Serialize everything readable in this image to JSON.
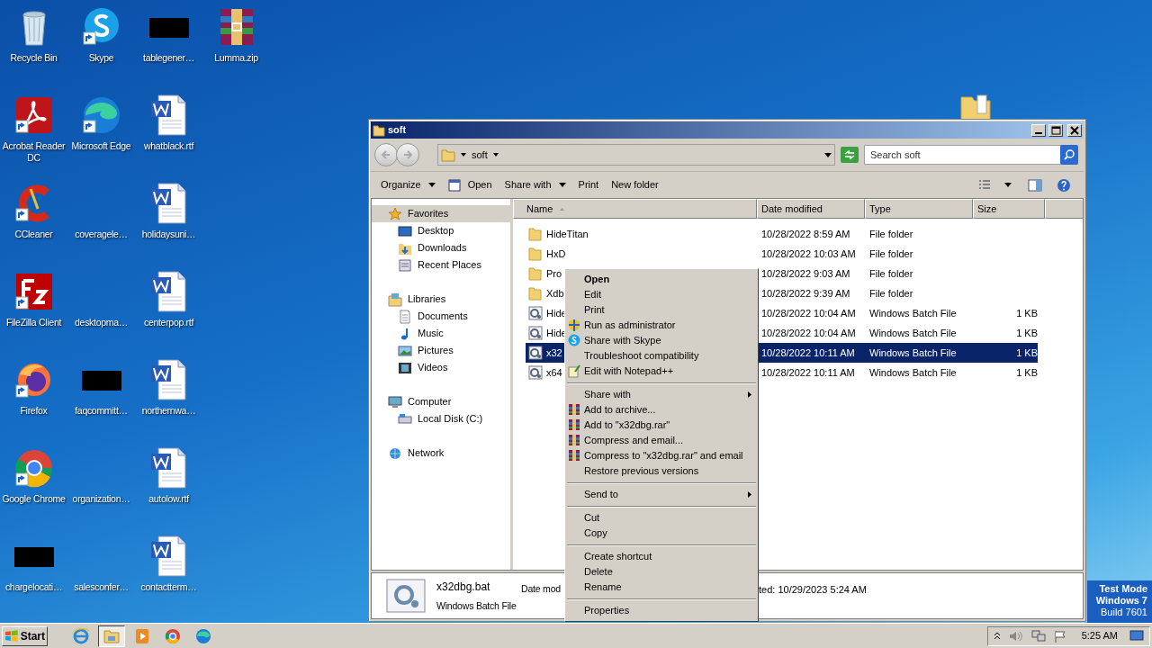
{
  "desktop": {
    "icons": [
      {
        "label": "Recycle Bin",
        "kind": "recycle"
      },
      {
        "label": "Acrobat Reader DC",
        "kind": "acrobat"
      },
      {
        "label": "CCleaner",
        "kind": "ccleaner"
      },
      {
        "label": "FileZilla Client",
        "kind": "filezilla"
      },
      {
        "label": "Firefox",
        "kind": "firefox"
      },
      {
        "label": "Google Chrome",
        "kind": "chrome"
      },
      {
        "label": "chargelocati…",
        "kind": "hidden"
      },
      {
        "label": "Skype",
        "kind": "skype"
      },
      {
        "label": "Microsoft Edge",
        "kind": "edge"
      },
      {
        "label": "coveragele…",
        "kind": "blank"
      },
      {
        "label": "desktopma…",
        "kind": "blank"
      },
      {
        "label": "faqcommitt…",
        "kind": "hidden"
      },
      {
        "label": "organization…",
        "kind": "blank"
      },
      {
        "label": "salesconfer…",
        "kind": "blank"
      },
      {
        "label": "tablegener…",
        "kind": "hidden"
      },
      {
        "label": "whatblack.rtf",
        "kind": "word"
      },
      {
        "label": "holidaysuni…",
        "kind": "word"
      },
      {
        "label": "centerpop.rtf",
        "kind": "word"
      },
      {
        "label": "northernwa…",
        "kind": "word"
      },
      {
        "label": "autolow.rtf",
        "kind": "word"
      },
      {
        "label": "contactterm…",
        "kind": "word"
      },
      {
        "label": "Lumma.zip",
        "kind": "winrar"
      }
    ],
    "os_notice": [
      "Test Mode",
      "Windows 7",
      "Build 7601"
    ]
  },
  "window": {
    "title": "soft",
    "address": "soft",
    "search": {
      "placeholder": "Search soft"
    },
    "toolbar": [
      {
        "label": "Organize",
        "kind": "dropdown"
      },
      {
        "label": "Open",
        "kind": "icon"
      },
      {
        "label": "Share with",
        "kind": "dropdown"
      },
      {
        "label": "Print",
        "kind": "plain"
      },
      {
        "label": "New folder",
        "kind": "plain"
      }
    ],
    "nav": [
      {
        "label": "Favorites",
        "kind": "star",
        "selected": true,
        "children": [
          {
            "label": "Desktop",
            "kind": "desktop",
            "selected": false
          },
          {
            "label": "Downloads",
            "kind": "downloads",
            "selected": false
          },
          {
            "label": "Recent Places",
            "kind": "recent",
            "selected": false
          }
        ]
      },
      {
        "label": "Libraries",
        "kind": "library",
        "selected": false,
        "children": [
          {
            "label": "Documents",
            "kind": "documents",
            "selected": false
          },
          {
            "label": "Music",
            "kind": "music",
            "selected": false
          },
          {
            "label": "Pictures",
            "kind": "pictures",
            "selected": false
          },
          {
            "label": "Videos",
            "kind": "videos",
            "selected": false
          }
        ]
      },
      {
        "label": "Computer",
        "kind": "computer",
        "selected": false,
        "children": [
          {
            "label": "Local Disk (C:)",
            "kind": "disk",
            "selected": false
          }
        ]
      },
      {
        "label": "Network",
        "kind": "network",
        "selected": false
      }
    ],
    "table": {
      "columns": [
        {
          "label": "Name",
          "sorted": true
        },
        {
          "label": "Date modified",
          "sorted": false
        },
        {
          "label": "Type",
          "sorted": false
        },
        {
          "label": "Size",
          "sorted": false
        }
      ],
      "rows": [
        {
          "name": "HideTitan",
          "date": "10/28/2022 8:59 AM",
          "type": "File folder",
          "kind": "folder",
          "selected": false
        },
        {
          "name": "HxD",
          "date": "10/28/2022 10:03 AM",
          "type": "File folder",
          "kind": "folder",
          "selected": false
        },
        {
          "name": "Pro",
          "date": "10/28/2022 9:03 AM",
          "type": "File folder",
          "kind": "folder",
          "selected": false
        },
        {
          "name": "Xdb",
          "date": "10/28/2022 9:39 AM",
          "type": "File folder",
          "kind": "folder",
          "selected": false
        },
        {
          "name": "Hide",
          "date": "10/28/2022 10:04 AM",
          "type": "Windows Batch File",
          "size": "1 KB",
          "kind": "batch",
          "selected": false
        },
        {
          "name": "Hide",
          "date": "10/28/2022 10:04 AM",
          "type": "Windows Batch File",
          "size": "1 KB",
          "kind": "batch",
          "selected": false
        },
        {
          "name": "x32",
          "date": "10/28/2022 10:11 AM",
          "type": "Windows Batch File",
          "size": "1 KB",
          "kind": "batch",
          "selected": true
        },
        {
          "name": "x64",
          "date": "10/28/2022 10:11 AM",
          "type": "Windows Batch File",
          "size": "1 KB",
          "kind": "batch",
          "selected": false
        }
      ]
    },
    "details": {
      "name": "x32dbg.bat",
      "type": "Windows Batch File",
      "date_label": "Date mod",
      "created": "ted: 10/29/2023 5:24 AM"
    }
  },
  "context_menu": {
    "items": [
      {
        "kind": "default",
        "label": "Open"
      },
      {
        "kind": "command",
        "label": "Edit"
      },
      {
        "kind": "command",
        "label": "Print"
      },
      {
        "kind": "admin",
        "label": "Run as administrator"
      },
      {
        "kind": "skype",
        "label": "Share with Skype"
      },
      {
        "kind": "command",
        "label": "Troubleshoot compatibility"
      },
      {
        "kind": "notepad",
        "label": "Edit with Notepad++"
      },
      {
        "kind": "separator"
      },
      {
        "kind": "submenu",
        "label": "Share with"
      },
      {
        "kind": "archive",
        "label": "Add to archive..."
      },
      {
        "kind": "archive",
        "label": "Add to \"x32dbg.rar\""
      },
      {
        "kind": "archive",
        "label": "Compress and email..."
      },
      {
        "kind": "archive",
        "label": "Compress to \"x32dbg.rar\" and email"
      },
      {
        "kind": "command",
        "label": "Restore previous versions"
      },
      {
        "kind": "separator"
      },
      {
        "kind": "submenu",
        "label": "Send to"
      },
      {
        "kind": "separator"
      },
      {
        "kind": "command",
        "label": "Cut"
      },
      {
        "kind": "command",
        "label": "Copy"
      },
      {
        "kind": "separator"
      },
      {
        "kind": "command",
        "label": "Create shortcut"
      },
      {
        "kind": "command",
        "label": "Delete"
      },
      {
        "kind": "command",
        "label": "Rename"
      },
      {
        "kind": "separator"
      },
      {
        "kind": "command",
        "label": "Properties"
      }
    ]
  },
  "taskbar": {
    "start": "Start",
    "apps": [
      {
        "kind": "ie",
        "active": false
      },
      {
        "kind": "explorer",
        "active": true
      },
      {
        "kind": "media",
        "active": false
      },
      {
        "kind": "chrome",
        "active": false
      },
      {
        "kind": "edge",
        "active": false
      }
    ],
    "clock": "5:25 AM"
  }
}
